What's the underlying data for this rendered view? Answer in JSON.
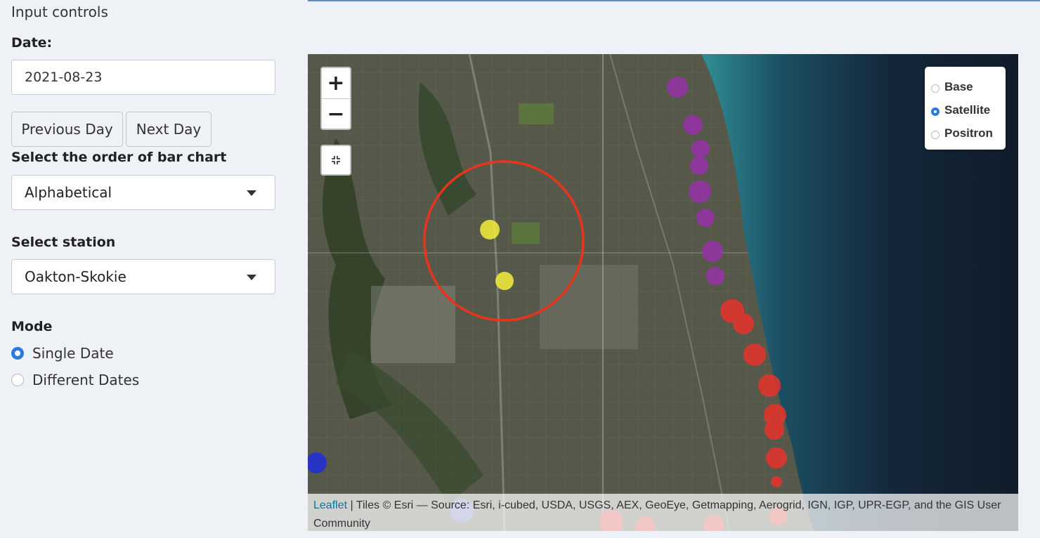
{
  "sidebar": {
    "title": "Input controls",
    "date_label": "Date:",
    "date_value": "2021-08-23",
    "prev_button": "Previous Day",
    "next_button": "Next Day",
    "order_label": "Select the order of bar chart",
    "order_value": "Alphabetical",
    "station_label": "Select station",
    "station_value": "Oakton-Skokie",
    "mode_label": "Mode",
    "mode_options": [
      {
        "label": "Single Date",
        "selected": true
      },
      {
        "label": "Different Dates",
        "selected": false
      }
    ]
  },
  "map": {
    "zoom_in": "+",
    "zoom_out": "−",
    "fullscreen_icon": "compress-icon",
    "layers": [
      {
        "label": "Base",
        "selected": false
      },
      {
        "label": "Satellite",
        "selected": true
      },
      {
        "label": "Positron",
        "selected": false
      }
    ],
    "attribution_link": "Leaflet",
    "attribution_text": " | Tiles © Esri — Source: Esri, i-cubed, USDA, USGS, AEX, GeoEye, Getmapping, Aerogrid, IGN, IGP, UPR-EGP, and the GIS User Community"
  },
  "colors": {
    "accent": "#2a7ae2",
    "highlight_ring": "#e8341c",
    "marker_yellow": "#f4ee3c",
    "marker_purple": "#9b2fae",
    "marker_red": "#f0302a",
    "marker_blue": "#1f2ed8"
  }
}
